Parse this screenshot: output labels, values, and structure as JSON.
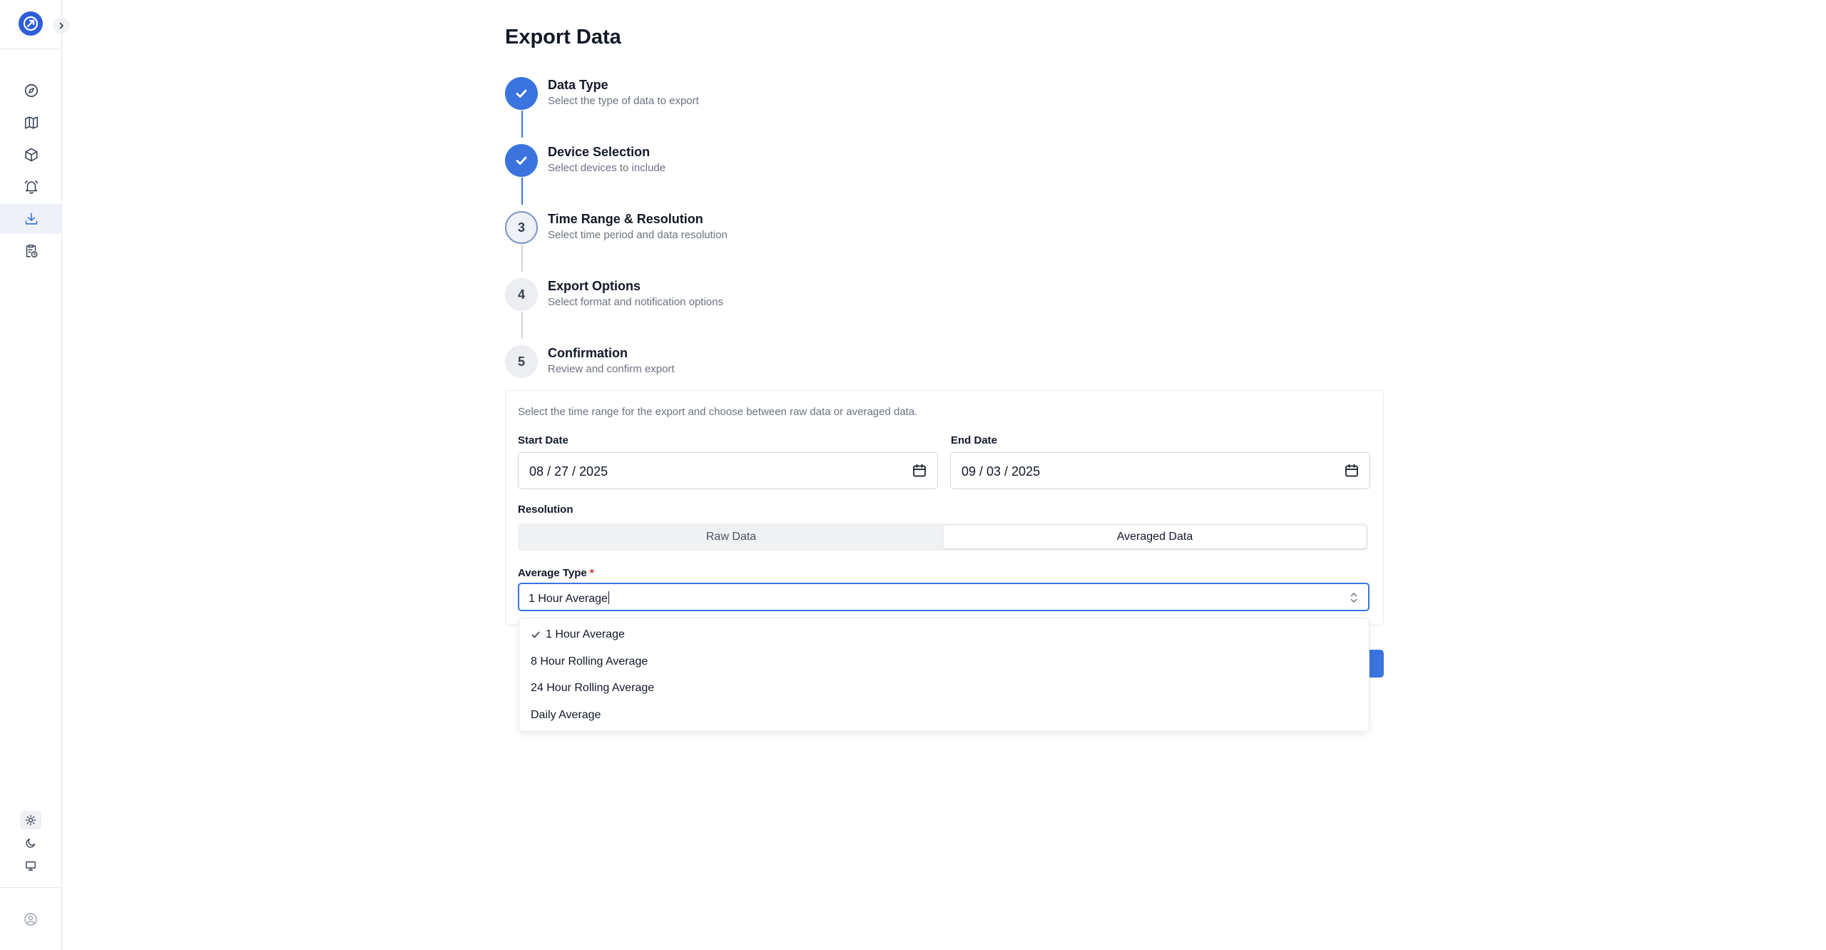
{
  "page": {
    "title": "Export Data"
  },
  "colors": {
    "accent": "#3b74df",
    "required": "#dc2626"
  },
  "sidebar": {
    "logo_icon": "app-logo-icon",
    "expand_icon": "chevron-right-icon",
    "nav": [
      {
        "name": "dashboard",
        "icon": "compass-icon",
        "active": false
      },
      {
        "name": "map",
        "icon": "map-icon",
        "active": false
      },
      {
        "name": "devices",
        "icon": "cube-icon",
        "active": false
      },
      {
        "name": "alerts",
        "icon": "bell-icon",
        "active": false
      },
      {
        "name": "export",
        "icon": "download-icon",
        "active": true
      },
      {
        "name": "reports",
        "icon": "clipboard-clock-icon",
        "active": false
      }
    ],
    "theme": [
      {
        "name": "light",
        "icon": "sun-icon",
        "active": true
      },
      {
        "name": "dark",
        "icon": "moon-icon",
        "active": false
      },
      {
        "name": "system",
        "icon": "monitor-icon",
        "active": false
      }
    ],
    "user_icon": "user-circle-icon"
  },
  "steps": [
    {
      "number": "1",
      "title": "Data Type",
      "subtitle": "Select the type of data to export",
      "status": "done"
    },
    {
      "number": "2",
      "title": "Device Selection",
      "subtitle": "Select devices to include",
      "status": "done"
    },
    {
      "number": "3",
      "title": "Time Range & Resolution",
      "subtitle": "Select time period and data resolution",
      "status": "current"
    },
    {
      "number": "4",
      "title": "Export Options",
      "subtitle": "Select format and notification options",
      "status": "todo"
    },
    {
      "number": "5",
      "title": "Confirmation",
      "subtitle": "Review and confirm export",
      "status": "todo"
    }
  ],
  "form": {
    "description": "Select the time range for the export and choose between raw data or averaged data.",
    "start_date": {
      "label": "Start Date",
      "value": "08 / 27 / 2025"
    },
    "end_date": {
      "label": "End Date",
      "value": "09 / 03 / 2025"
    },
    "resolution": {
      "label": "Resolution",
      "options": [
        "Raw Data",
        "Averaged Data"
      ],
      "selected": "Averaged Data"
    },
    "average_type": {
      "label": "Average Type",
      "required_mark": "*",
      "value": "1 Hour Average",
      "options": [
        "1 Hour Average",
        "8 Hour Rolling Average",
        "24 Hour Rolling Average",
        "Daily Average"
      ],
      "selected": "1 Hour Average"
    }
  }
}
